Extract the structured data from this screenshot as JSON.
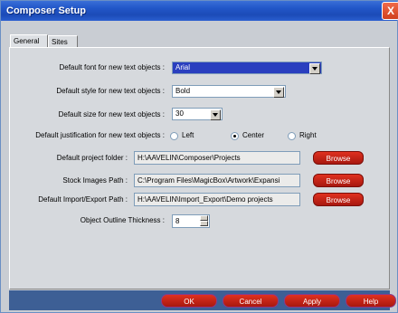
{
  "window": {
    "title": "Composer Setup",
    "close_label": "X"
  },
  "tabs": [
    {
      "label": "General"
    },
    {
      "label": "Sites"
    }
  ],
  "fields": {
    "font_label": "Default font for new text objects :",
    "font_value": "Arial",
    "style_label": "Default style for new text objects :",
    "style_value": "Bold",
    "size_label": "Default size for new text objects :",
    "size_value": "30",
    "justification_label": "Default justification for new text objects :",
    "justification_options": [
      "Left",
      "Center",
      "Right"
    ],
    "justification_selected": "Center",
    "project_folder_label": "Default project folder :",
    "project_folder_value": "H:\\AAVELIN\\Composer\\Projects",
    "stock_images_label": "Stock Images Path :",
    "stock_images_value": "C:\\Program Files\\MagicBox\\Artwork\\Expansi",
    "import_export_label": "Default Import/Export Path :",
    "import_export_value": "H:\\AAVELIN\\Import_Export\\Demo projects",
    "outline_label": "Object Outline Thickness :",
    "outline_value": "8",
    "browse_label": "Browse"
  },
  "buttons": {
    "ok": "OK",
    "cancel": "Cancel",
    "apply": "Apply",
    "help": "Help"
  }
}
